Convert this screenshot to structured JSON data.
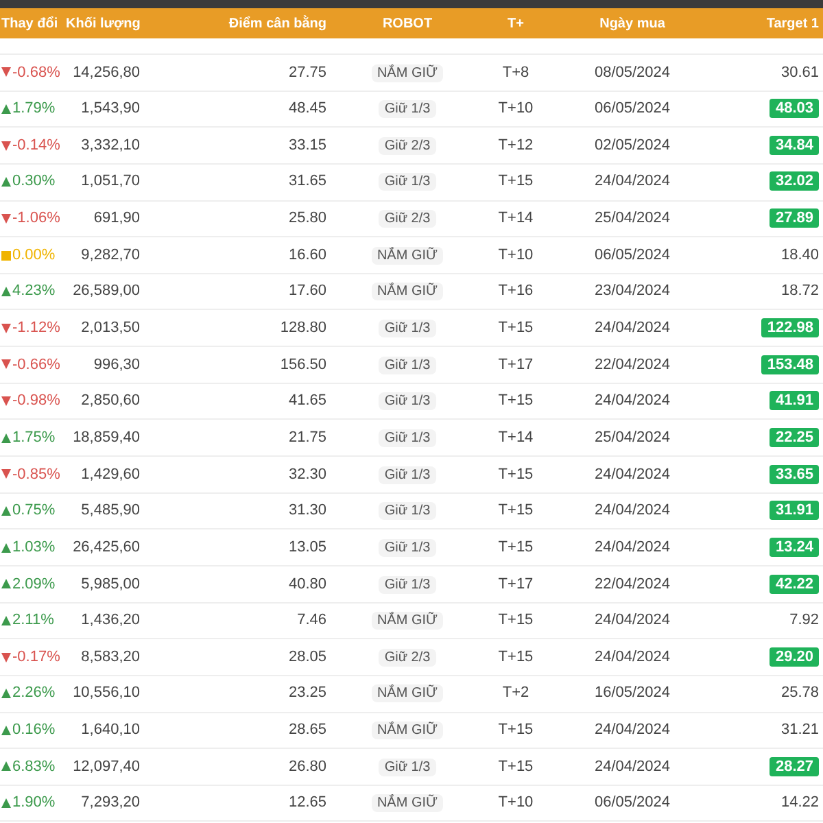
{
  "header": [
    "Thay đổi",
    "Khối lượng",
    "Điểm cân bằng",
    "ROBOT",
    "T+",
    "Ngày mua",
    "Target 1"
  ],
  "rows": [
    {
      "kind": "down",
      "change": "-0.68%",
      "volume": "14,256,80",
      "balance": "27.75",
      "robot": "NẮM GIỮ",
      "t": "T+8",
      "date": "08/05/2024",
      "target": "30.61",
      "hit": false
    },
    {
      "kind": "up",
      "change": "1.79%",
      "volume": "1,543,90",
      "balance": "48.45",
      "robot": "Giữ 1/3",
      "t": "T+10",
      "date": "06/05/2024",
      "target": "48.03",
      "hit": true
    },
    {
      "kind": "down",
      "change": "-0.14%",
      "volume": "3,332,10",
      "balance": "33.15",
      "robot": "Giữ 2/3",
      "t": "T+12",
      "date": "02/05/2024",
      "target": "34.84",
      "hit": true
    },
    {
      "kind": "up",
      "change": "0.30%",
      "volume": "1,051,70",
      "balance": "31.65",
      "robot": "Giữ 1/3",
      "t": "T+15",
      "date": "24/04/2024",
      "target": "32.02",
      "hit": true
    },
    {
      "kind": "down",
      "change": "-1.06%",
      "volume": "691,90",
      "balance": "25.80",
      "robot": "Giữ 2/3",
      "t": "T+14",
      "date": "25/04/2024",
      "target": "27.89",
      "hit": true
    },
    {
      "kind": "flat",
      "change": "0.00%",
      "volume": "9,282,70",
      "balance": "16.60",
      "robot": "NẮM GIỮ",
      "t": "T+10",
      "date": "06/05/2024",
      "target": "18.40",
      "hit": false
    },
    {
      "kind": "up",
      "change": "4.23%",
      "volume": "26,589,00",
      "balance": "17.60",
      "robot": "NẮM GIỮ",
      "t": "T+16",
      "date": "23/04/2024",
      "target": "18.72",
      "hit": false
    },
    {
      "kind": "down",
      "change": "-1.12%",
      "volume": "2,013,50",
      "balance": "128.80",
      "robot": "Giữ 1/3",
      "t": "T+15",
      "date": "24/04/2024",
      "target": "122.98",
      "hit": true
    },
    {
      "kind": "down",
      "change": "-0.66%",
      "volume": "996,30",
      "balance": "156.50",
      "robot": "Giữ 1/3",
      "t": "T+17",
      "date": "22/04/2024",
      "target": "153.48",
      "hit": true
    },
    {
      "kind": "down",
      "change": "-0.98%",
      "volume": "2,850,60",
      "balance": "41.65",
      "robot": "Giữ 1/3",
      "t": "T+15",
      "date": "24/04/2024",
      "target": "41.91",
      "hit": true
    },
    {
      "kind": "up",
      "change": "1.75%",
      "volume": "18,859,40",
      "balance": "21.75",
      "robot": "Giữ 1/3",
      "t": "T+14",
      "date": "25/04/2024",
      "target": "22.25",
      "hit": true
    },
    {
      "kind": "down",
      "change": "-0.85%",
      "volume": "1,429,60",
      "balance": "32.30",
      "robot": "Giữ 1/3",
      "t": "T+15",
      "date": "24/04/2024",
      "target": "33.65",
      "hit": true
    },
    {
      "kind": "up",
      "change": "0.75%",
      "volume": "5,485,90",
      "balance": "31.30",
      "robot": "Giữ 1/3",
      "t": "T+15",
      "date": "24/04/2024",
      "target": "31.91",
      "hit": true
    },
    {
      "kind": "up",
      "change": "1.03%",
      "volume": "26,425,60",
      "balance": "13.05",
      "robot": "Giữ 1/3",
      "t": "T+15",
      "date": "24/04/2024",
      "target": "13.24",
      "hit": true
    },
    {
      "kind": "up",
      "change": "2.09%",
      "volume": "5,985,00",
      "balance": "40.80",
      "robot": "Giữ 1/3",
      "t": "T+17",
      "date": "22/04/2024",
      "target": "42.22",
      "hit": true
    },
    {
      "kind": "up",
      "change": "2.11%",
      "volume": "1,436,20",
      "balance": "7.46",
      "robot": "NẮM GIỮ",
      "t": "T+15",
      "date": "24/04/2024",
      "target": "7.92",
      "hit": false
    },
    {
      "kind": "down",
      "change": "-0.17%",
      "volume": "8,583,20",
      "balance": "28.05",
      "robot": "Giữ 2/3",
      "t": "T+15",
      "date": "24/04/2024",
      "target": "29.20",
      "hit": true
    },
    {
      "kind": "up",
      "change": "2.26%",
      "volume": "10,556,10",
      "balance": "23.25",
      "robot": "NẮM GIỮ",
      "t": "T+2",
      "date": "16/05/2024",
      "target": "25.78",
      "hit": false
    },
    {
      "kind": "up",
      "change": "0.16%",
      "volume": "1,640,10",
      "balance": "28.65",
      "robot": "NẮM GIỮ",
      "t": "T+15",
      "date": "24/04/2024",
      "target": "31.21",
      "hit": false
    },
    {
      "kind": "up",
      "change": "6.83%",
      "volume": "12,097,40",
      "balance": "26.80",
      "robot": "Giữ 1/3",
      "t": "T+15",
      "date": "24/04/2024",
      "target": "28.27",
      "hit": true
    },
    {
      "kind": "up",
      "change": "1.90%",
      "volume": "7,293,20",
      "balance": "12.65",
      "robot": "NẮM GIỮ",
      "t": "T+10",
      "date": "06/05/2024",
      "target": "14.22",
      "hit": false
    }
  ]
}
